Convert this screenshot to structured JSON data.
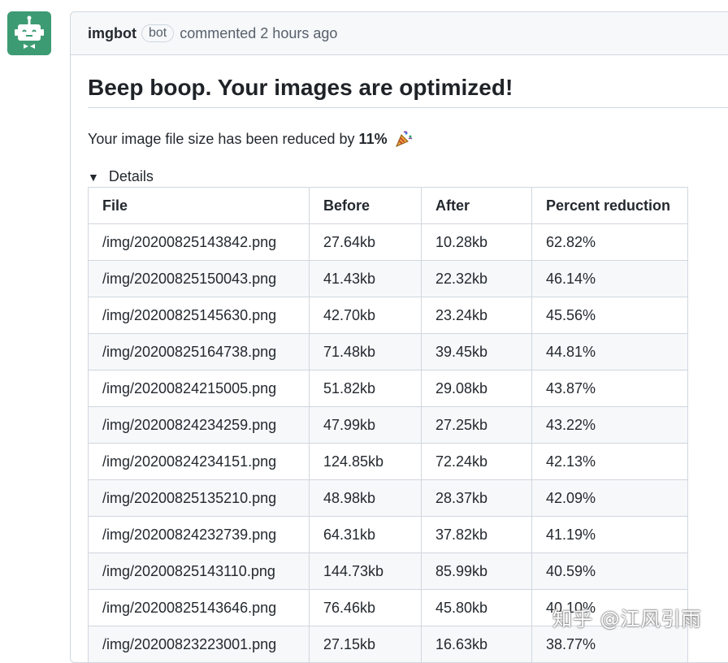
{
  "comment": {
    "author": "imgbot",
    "badge": "bot",
    "action": "commented 2 hours ago",
    "title": "Beep boop. Your images are optimized!",
    "summary_prefix": "Your image file size has been reduced by",
    "summary_value": "11%",
    "details_label": "Details"
  },
  "table": {
    "headers": [
      "File",
      "Before",
      "After",
      "Percent reduction"
    ],
    "rows": [
      [
        "/img/20200825143842.png",
        "27.64kb",
        "10.28kb",
        "62.82%"
      ],
      [
        "/img/20200825150043.png",
        "41.43kb",
        "22.32kb",
        "46.14%"
      ],
      [
        "/img/20200825145630.png",
        "42.70kb",
        "23.24kb",
        "45.56%"
      ],
      [
        "/img/20200825164738.png",
        "71.48kb",
        "39.45kb",
        "44.81%"
      ],
      [
        "/img/20200824215005.png",
        "51.82kb",
        "29.08kb",
        "43.87%"
      ],
      [
        "/img/20200824234259.png",
        "47.99kb",
        "27.25kb",
        "43.22%"
      ],
      [
        "/img/20200824234151.png",
        "124.85kb",
        "72.24kb",
        "42.13%"
      ],
      [
        "/img/20200825135210.png",
        "48.98kb",
        "28.37kb",
        "42.09%"
      ],
      [
        "/img/20200824232739.png",
        "64.31kb",
        "37.82kb",
        "41.19%"
      ],
      [
        "/img/20200825143110.png",
        "144.73kb",
        "85.99kb",
        "40.59%"
      ],
      [
        "/img/20200825143646.png",
        "76.46kb",
        "45.80kb",
        "40.10%"
      ],
      [
        "/img/20200823223001.png",
        "27.15kb",
        "16.63kb",
        "38.77%"
      ]
    ]
  },
  "watermark": "知乎 @江风引雨",
  "colors": {
    "avatar_bg": "#3d9b73",
    "border": "#d0d7de",
    "header_bg": "#f6f8fa"
  }
}
